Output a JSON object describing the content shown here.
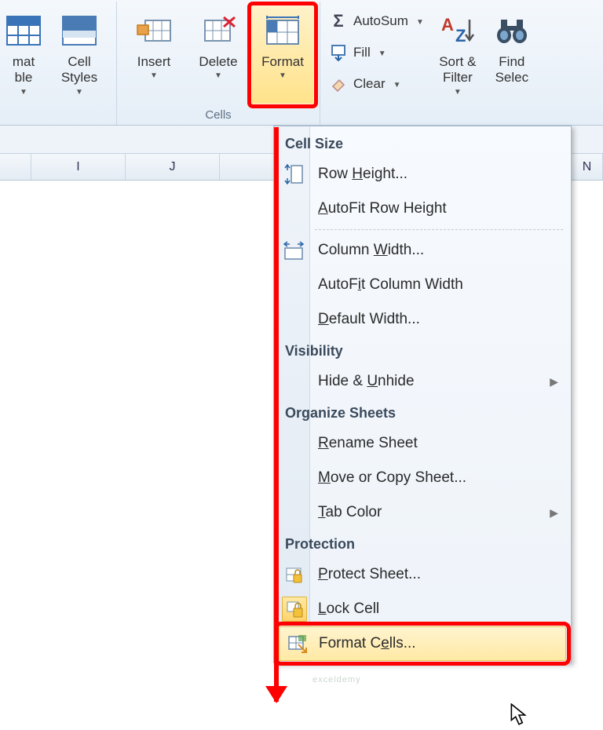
{
  "ribbon": {
    "styles": {
      "formatTable": "mat\nble",
      "cellStyles": "Cell\nStyles"
    },
    "cells": {
      "insert": "Insert",
      "delete": "Delete",
      "format": "Format",
      "groupLabel": "Cells"
    },
    "editing": {
      "autosum": "AutoSum",
      "fill": "Fill",
      "clear": "Clear",
      "sortFilter": "Sort &\nFilter",
      "findSelect": "Find\nSelec"
    }
  },
  "columns": {
    "I": "I",
    "J": "J",
    "N": "N"
  },
  "menu": {
    "sections": {
      "cellSize": "Cell Size",
      "visibility": "Visibility",
      "organize": "Organize Sheets",
      "protection": "Protection"
    },
    "items": {
      "rowHeight": "Row Height...",
      "autofitRow": "AutoFit Row Height",
      "colWidth": "Column Width...",
      "autofitCol": "AutoFit Column Width",
      "defaultWidth": "Default Width...",
      "hideUnhide": "Hide & Unhide",
      "renameSheet": "Rename Sheet",
      "moveCopy": "Move or Copy Sheet...",
      "tabColor": "Tab Color",
      "protectSheet": "Protect Sheet...",
      "lockCell": "Lock Cell",
      "formatCells": "Format Cells..."
    }
  },
  "watermark": "exceldemy"
}
